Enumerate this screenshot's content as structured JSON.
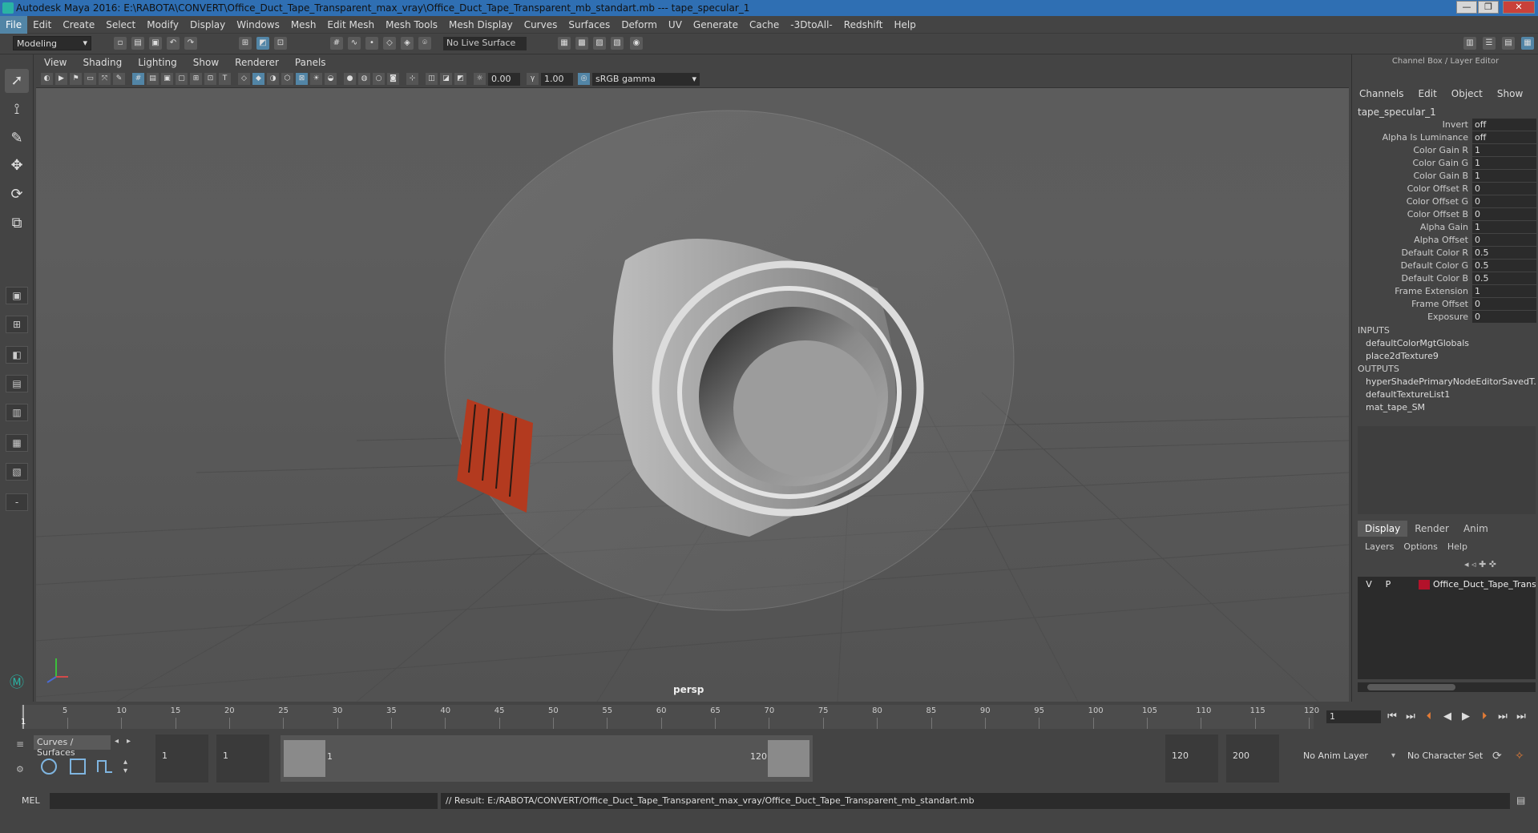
{
  "window": {
    "title": "Autodesk Maya 2016: E:\\RABOTA\\CONVERT\\Office_Duct_Tape_Transparent_max_vray\\Office_Duct_Tape_Transparent_mb_standart.mb  ---  tape_specular_1",
    "minimize": "—",
    "maximize": "❐",
    "close": "✕"
  },
  "menubar": [
    "File",
    "Edit",
    "Create",
    "Select",
    "Modify",
    "Display",
    "Windows",
    "Mesh",
    "Edit Mesh",
    "Mesh Tools",
    "Mesh Display",
    "Curves",
    "Surfaces",
    "Deform",
    "UV",
    "Generate",
    "Cache",
    "-3DtoAll-",
    "Redshift",
    "Help"
  ],
  "shelf": {
    "mode": "Modeling",
    "live_surface": "No Live Surface"
  },
  "viewport": {
    "menus": [
      "View",
      "Shading",
      "Lighting",
      "Show",
      "Renderer",
      "Panels"
    ],
    "exposure": "0.00",
    "gamma": "1.00",
    "color_space": "sRGB gamma",
    "camera_label": "persp"
  },
  "channel_box": {
    "header": "Channel Box / Layer Editor",
    "tabs": [
      "Channels",
      "Edit",
      "Object",
      "Show"
    ],
    "node": "tape_specular_1",
    "attributes": [
      {
        "label": "Invert",
        "value": "off"
      },
      {
        "label": "Alpha Is Luminance",
        "value": "off"
      },
      {
        "label": "Color Gain R",
        "value": "1"
      },
      {
        "label": "Color Gain G",
        "value": "1"
      },
      {
        "label": "Color Gain B",
        "value": "1"
      },
      {
        "label": "Color Offset R",
        "value": "0"
      },
      {
        "label": "Color Offset G",
        "value": "0"
      },
      {
        "label": "Color Offset B",
        "value": "0"
      },
      {
        "label": "Alpha Gain",
        "value": "1"
      },
      {
        "label": "Alpha Offset",
        "value": "0"
      },
      {
        "label": "Default Color R",
        "value": "0.5"
      },
      {
        "label": "Default Color G",
        "value": "0.5"
      },
      {
        "label": "Default Color B",
        "value": "0.5"
      },
      {
        "label": "Frame Extension",
        "value": "1"
      },
      {
        "label": "Frame Offset",
        "value": "0"
      },
      {
        "label": "Exposure",
        "value": "0"
      }
    ],
    "inputs_label": "INPUTS",
    "inputs": [
      "defaultColorMgtGlobals",
      "place2dTexture9"
    ],
    "outputs_label": "OUTPUTS",
    "outputs": [
      "hyperShadePrimaryNodeEditorSavedT...",
      "defaultTextureList1",
      "mat_tape_SM"
    ]
  },
  "layer_editor": {
    "tabs": [
      "Display",
      "Render",
      "Anim"
    ],
    "menus": [
      "Layers",
      "Options",
      "Help"
    ],
    "layer": {
      "v": "V",
      "p": "P",
      "name": "Office_Duct_Tape_Transp",
      "color": "#b3122a"
    }
  },
  "timeline": {
    "ticks": [
      "5",
      "10",
      "15",
      "20",
      "25",
      "30",
      "35",
      "40",
      "45",
      "50",
      "55",
      "60",
      "65",
      "70",
      "75",
      "80",
      "85",
      "90",
      "95",
      "100",
      "105",
      "110",
      "115",
      "120"
    ],
    "start": "1",
    "current_frame": "1"
  },
  "range": {
    "shelf_tab": "Curves / Surfaces",
    "start": "1",
    "playback_start": "1",
    "slider_start": "1",
    "slider_end": "120",
    "playback_end": "120",
    "end": "200",
    "anim_layer": "No Anim Layer",
    "character_set": "No Character Set"
  },
  "command": {
    "label": "MEL",
    "result": "// Result: E:/RABOTA/CONVERT/Office_Duct_Tape_Transparent_max_vray/Office_Duct_Tape_Transparent_mb_standart.mb"
  },
  "colors": {
    "accent": "#5285a6",
    "titlebar": "#2f6fb3",
    "layer_color": "#b3122a"
  }
}
